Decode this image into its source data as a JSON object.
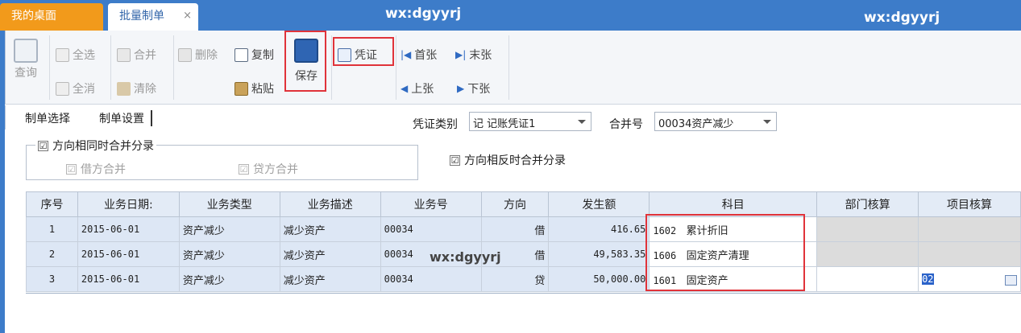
{
  "tabs": {
    "desktop": "我的桌面",
    "batch": "批量制单",
    "close": "×"
  },
  "watermark": "wx:dgyyrj",
  "toolbar": {
    "query": "查询",
    "select_all": "全选",
    "deselect_all": "全消",
    "merge": "合并",
    "clear": "清除",
    "delete": "删除",
    "copy": "复制",
    "paste": "粘贴",
    "save": "保存",
    "voucher": "凭证",
    "first": "首张",
    "last": "末张",
    "prev": "上张",
    "next": "下张"
  },
  "subtabs": {
    "select": "制单选择",
    "settings": "制单设置"
  },
  "form": {
    "voucher_type_label": "凭证类别",
    "voucher_type_value": "记 记账凭证1",
    "merge_no_label": "合并号",
    "merge_no_value": "00034资产减少",
    "same_dir": "方向相同时合并分录",
    "debit_merge": "借方合并",
    "credit_merge": "贷方合并",
    "opposite_dir": "方向相反时合并分录",
    "check_mark": "☑"
  },
  "grid": {
    "headers": [
      "序号",
      "业务日期:",
      "业务类型",
      "业务描述",
      "业务号",
      "方向",
      "发生额",
      "科目",
      "部门核算",
      "项目核算"
    ],
    "rows": [
      {
        "no": "1",
        "date": "2015-06-01",
        "type": "资产减少",
        "desc": "减少资产",
        "biz_no": "00034",
        "dir": "借",
        "amount": "416.65",
        "acct_code": "1602",
        "acct_name": "累计折旧"
      },
      {
        "no": "2",
        "date": "2015-06-01",
        "type": "资产减少",
        "desc": "减少资产",
        "biz_no": "00034",
        "dir": "借",
        "amount": "49,583.35",
        "acct_code": "1606",
        "acct_name": "固定资产清理"
      },
      {
        "no": "3",
        "date": "2015-06-01",
        "type": "资产减少",
        "desc": "减少资产",
        "biz_no": "00034",
        "dir": "贷",
        "amount": "50,000.00",
        "acct_code": "1601",
        "acct_name": "固定资产",
        "project_value": "02"
      }
    ]
  },
  "colors": {
    "accent": "#3d7cc9",
    "tab_orange": "#f29a1b",
    "highlight_red": "#e0333a"
  }
}
